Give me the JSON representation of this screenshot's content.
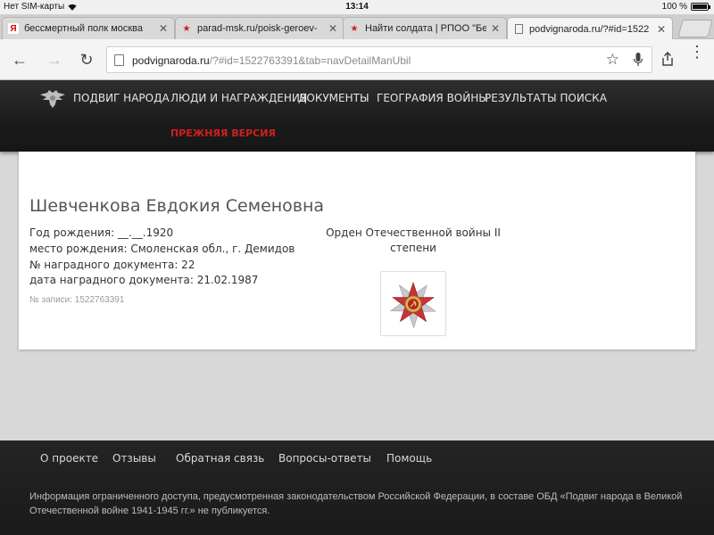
{
  "status_bar": {
    "carrier": "Нет SIM-карты",
    "time": "13:14",
    "battery": "100 %",
    "battery_level": 1.0
  },
  "tabs": [
    {
      "title": "бессмертный полк москва",
      "favicon": "yandex-icon",
      "active": false
    },
    {
      "title": "parad-msk.ru/poisk-geroev-",
      "favicon": "red-star-icon",
      "active": false
    },
    {
      "title": "Найти солдата | РПОО \"Бе",
      "favicon": "red-star-icon",
      "active": false
    },
    {
      "title": "podvignaroda.ru/?#id=1522",
      "favicon": "page-icon",
      "active": true
    }
  ],
  "toolbar": {
    "url_host": "podvignaroda.ru",
    "url_rest": "/?#id=1522763391&tab=navDetailManUbil"
  },
  "site_nav": {
    "items": [
      "ПОДВИГ НАРОДА",
      "ЛЮДИ И НАГРАЖДЕНИЯ",
      "ДОКУМЕНТЫ",
      "ГЕОГРАФИЯ ВОЙНЫ",
      "РЕЗУЛЬТАТЫ ПОИСКА"
    ],
    "previous_version": "ПРЕЖНЯЯ ВЕРСИЯ"
  },
  "person": {
    "name": "Шевченкова Евдокия Семеновна",
    "birth_year": "Год рождения: __.__.1920",
    "birth_place": "место рождения: Смоленская обл., г. Демидов",
    "doc_number": "№ наградного документа: 22",
    "doc_date": "дата наградного документа: 21.02.1987",
    "record_id": "№ записи: 1522763391"
  },
  "award": {
    "title_line1": "Орден Отечественной войны II",
    "title_line2": "степени"
  },
  "footer": {
    "links": [
      "О проекте",
      "Отзывы",
      "Обратная связь",
      "Вопросы-ответы",
      "Помощь"
    ],
    "note": "Информация ограниченного доступа, предусмотренная законодательством Российской Федерации, в составе ОБД «Подвиг народа в Великой Отечественной войне 1941-1945 гг.» не публикуется."
  },
  "colors": {
    "accent_red": "#d21e1e",
    "header_bg": "#1b1b1b",
    "footer_bg": "#1f1f1f"
  }
}
